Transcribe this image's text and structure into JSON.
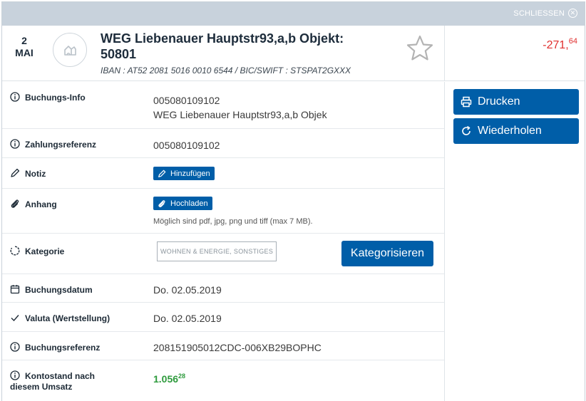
{
  "topbar": {
    "close_label": "SCHLIESSEN"
  },
  "header": {
    "day": "2",
    "month": "MAI",
    "title_line1": "WEG Liebenauer Hauptstr93,a,b Objekt:",
    "title_line2": "50801",
    "iban": "IBAN : AT52 2081 5016 0010 6544 / BIC/SWIFT : STSPAT2GXXX",
    "amount_main": "-271,",
    "amount_cents": "64"
  },
  "details": {
    "buchungsinfo": {
      "label": "Buchungs-Info",
      "line1": "005080109102",
      "line2": "WEG Liebenauer Hauptstr93,a,b Objek"
    },
    "zahlungsreferenz": {
      "label": "Zahlungsreferenz",
      "value": "005080109102"
    },
    "notiz": {
      "label": "Notiz",
      "button": "Hinzufügen"
    },
    "anhang": {
      "label": "Anhang",
      "button": "Hochladen",
      "hint": "Möglich sind pdf, jpg, png und tiff (max 7 MB)."
    },
    "kategorie": {
      "label": "Kategorie",
      "tag": "WOHNEN & ENERGIE, SONSTIGES",
      "button": "Kategorisieren"
    },
    "buchungsdatum": {
      "label": "Buchungsdatum",
      "value": "Do. 02.05.2019"
    },
    "valuta": {
      "label": "Valuta (Wertstellung)",
      "value": "Do. 02.05.2019"
    },
    "buchungsreferenz": {
      "label": "Buchungsreferenz",
      "value": "208151905012CDC-006XB29BOPHC"
    },
    "kontostand": {
      "label_line1": "Kontostand nach",
      "label_line2": "diesem Umsatz",
      "value_main": "1.056",
      "value_cents": "28"
    }
  },
  "actions": {
    "print": "Drucken",
    "repeat": "Wiederholen"
  },
  "colors": {
    "accent": "#005ea8",
    "negative": "#e0302f",
    "positive": "#2d9a3c"
  }
}
